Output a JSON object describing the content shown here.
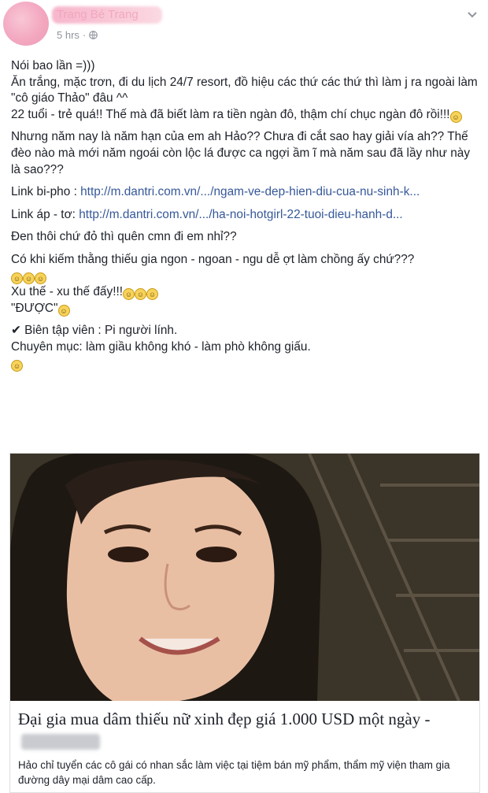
{
  "post": {
    "author": "Trang Bé Trang",
    "time": "5 hrs",
    "body": {
      "line1": "Nói bao lần =)))",
      "line2": "Ăn trắng, mặc trơn, đi du lịch 24/7 resort, đồ hiệu các thứ các thứ thì làm j ra ngoài làm \"cô giáo Thảo\" đâu ^^",
      "line3": "22 tuổi - trẻ quá!! Thế mà đã biết làm ra tiền ngàn đô, thậm chí chục ngàn đô rồi!!!",
      "para2": "Nhưng năm nay là năm hạn của em ah Hảo?? Chưa đi cắt sao hay giải vía ah?? Thế đèo nào mà mới năm ngoái còn lộc lá được ca ngợi ầm ĩ mà năm sau đã lầy như này là sao???",
      "link1_label": "Link bi-pho : ",
      "link1_url": "http://m.dantri.com.vn/.../ngam-ve-dep-hien-diu-cua-nu-sinh-k...",
      "link2_label": "Link áp - tơ: ",
      "link2_url": "http://m.dantri.com.vn/.../ha-noi-hotgirl-22-tuoi-dieu-hanh-d...",
      "para5": "Đen thôi chứ đỏ thì quên cmn đi em nhỉ??",
      "para6": "Có khi kiếm thằng thiếu gia ngon - ngoan - ngu dễ ợt làm chồng ấy chứ???",
      "para7a": "Xu thế - xu thế đấy!!!",
      "para7b": "\"ĐƯỢC\"",
      "para8a": "✔ Biên tập viên : Pi người lính.",
      "para8b": "Chuyên mục: làm giầu không khó - làm phò không giấu."
    },
    "card": {
      "title": "Đại gia mua dâm thiếu nữ xinh đẹp giá 1.000 USD một ngày -",
      "description": "Hảo chỉ tuyển các cô gái có nhan sắc làm việc tại tiệm bán mỹ phẩm, thẩm mỹ viện tham gia đường dây mại dâm cao cấp."
    }
  },
  "icons": {
    "globe": "globe-icon",
    "menu": "chevron-down-icon",
    "emoji": "laughing-emoji-icon"
  },
  "colors": {
    "link": "#365899",
    "text": "#1d2129",
    "meta": "#90949c"
  }
}
